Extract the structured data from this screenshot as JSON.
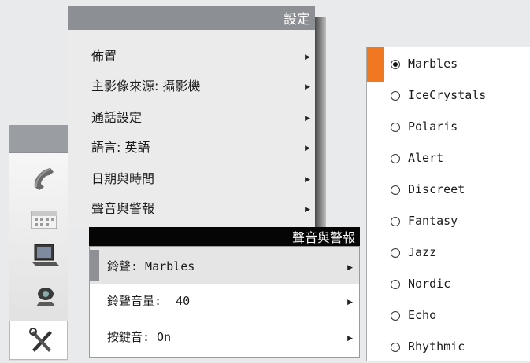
{
  "main_menu": {
    "title": "設定",
    "items": [
      {
        "label": "佈置"
      },
      {
        "label": "主影像來源: 攝影機"
      },
      {
        "label": "通話設定"
      },
      {
        "label": "語言: 英語"
      },
      {
        "label": "日期與時間"
      },
      {
        "label": "聲音與警報"
      }
    ],
    "arrow_glyph": "▶"
  },
  "sound_menu": {
    "title": "聲音與警報",
    "items": [
      {
        "label": "鈴聲: Marbles"
      },
      {
        "label": "鈴聲音量:  40"
      },
      {
        "label": "按鍵音: On"
      }
    ]
  },
  "ringtones": {
    "selected": "Marbles",
    "options": [
      "Marbles",
      "IceCrystals",
      "Polaris",
      "Alert",
      "Discreet",
      "Fantasy",
      "Jazz",
      "Nordic",
      "Echo",
      "Rhythmic"
    ]
  },
  "sidebar_icons": [
    "phone-icon",
    "calendar-icon",
    "laptop-icon",
    "camera-icon",
    "tools-icon"
  ],
  "colors": {
    "accent": "#f07820",
    "title_bar": "#8c8f94",
    "sub_title_bar": "#050505"
  }
}
